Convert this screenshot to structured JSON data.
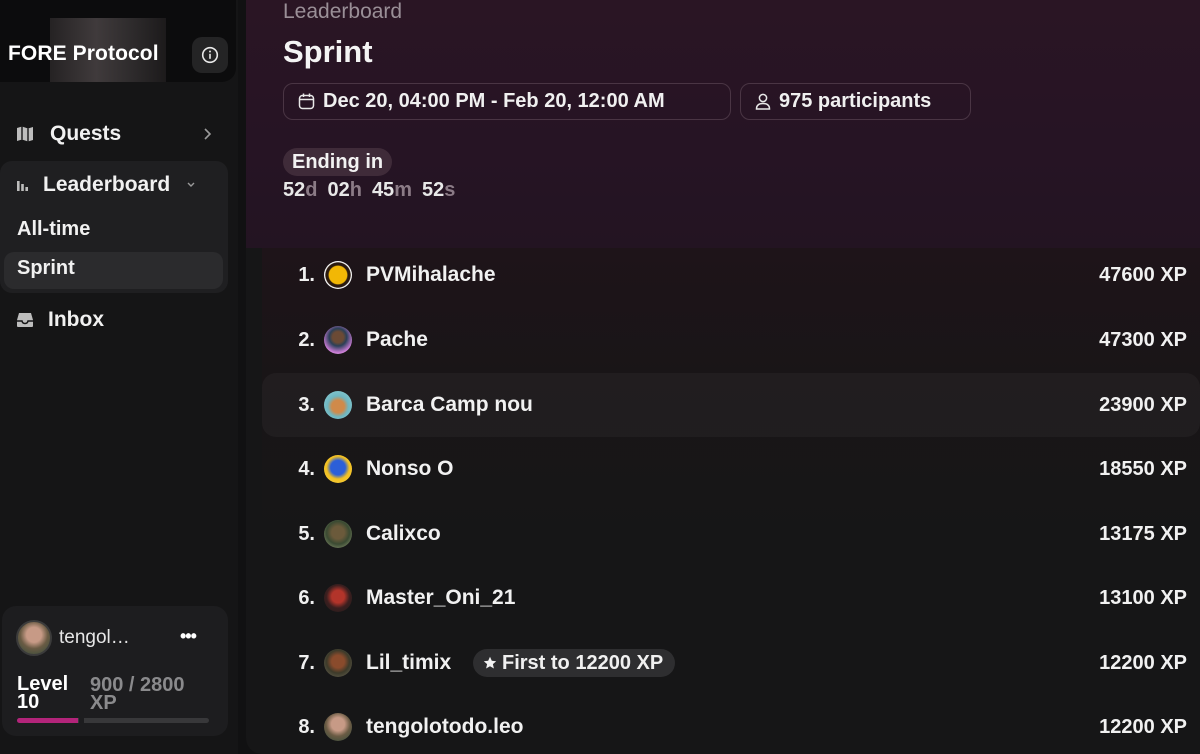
{
  "sidebar": {
    "brand": "FORE Protocol",
    "nav": {
      "quests": "Quests",
      "leaderboard": "Leaderboard",
      "all_time": "All-time",
      "sprint": "Sprint",
      "inbox": "Inbox"
    },
    "user": {
      "name": "tengol…",
      "more": "•••",
      "level_label": "Level 10",
      "xp_text": "900 / 2800 XP",
      "xp_progress": 0.32
    }
  },
  "header": {
    "breadcrumb": "Leaderboard",
    "title": "Sprint",
    "date_range": "Dec 20, 04:00 PM - Feb 20, 12:00 AM",
    "participants": "975 participants",
    "ending_label": "Ending in",
    "countdown": {
      "days": "52",
      "days_unit": "d",
      "hours": "02",
      "hours_unit": "h",
      "minutes": "45",
      "minutes_unit": "m",
      "seconds": "52",
      "seconds_unit": "s"
    }
  },
  "leaderboard": [
    {
      "rank": "1.",
      "name": "PVMihalache",
      "xp": "47600 XP"
    },
    {
      "rank": "2.",
      "name": "Pache",
      "xp": "47300 XP"
    },
    {
      "rank": "3.",
      "name": "Barca Camp nou",
      "xp": "23900 XP"
    },
    {
      "rank": "4.",
      "name": "Nonso O",
      "xp": "18550 XP"
    },
    {
      "rank": "5.",
      "name": "Calixco",
      "xp": "13175 XP"
    },
    {
      "rank": "6.",
      "name": "Master_Oni_21",
      "xp": "13100 XP"
    },
    {
      "rank": "7.",
      "name": "Lil_timix",
      "xp": "12200 XP",
      "badge": "First to 12200 XP"
    },
    {
      "rank": "8.",
      "name": "tengolotodo.leo",
      "xp": "12200 XP"
    }
  ],
  "colors": {
    "accent": "#b3247a",
    "hero_bg": "#2a1524"
  }
}
